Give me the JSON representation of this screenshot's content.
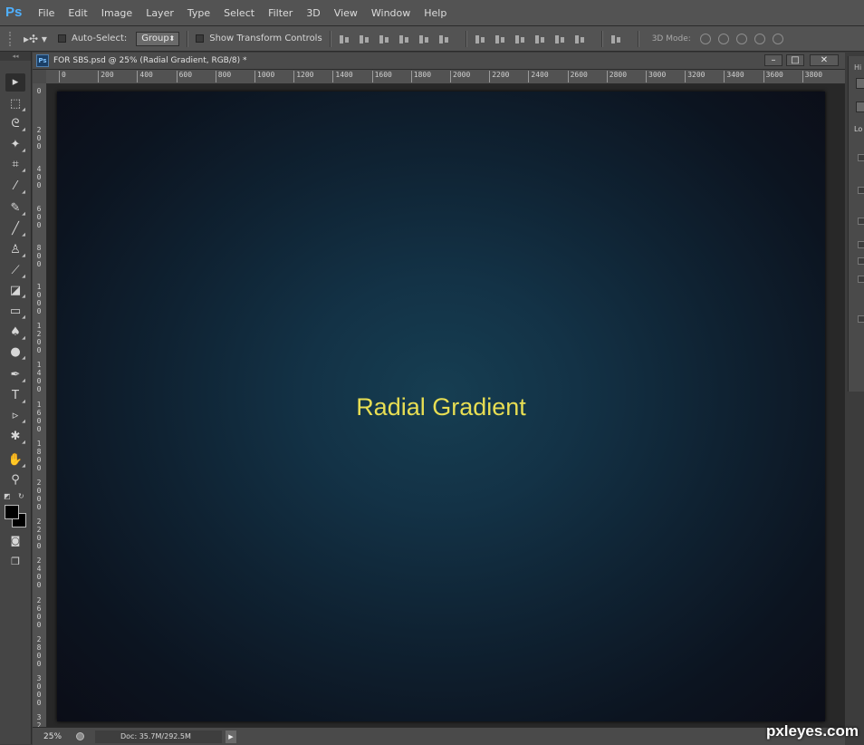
{
  "app": {
    "logo": "Ps"
  },
  "menu": [
    "File",
    "Edit",
    "Image",
    "Layer",
    "Type",
    "Select",
    "Filter",
    "3D",
    "View",
    "Window",
    "Help"
  ],
  "options_bar": {
    "move_glyph": "▸✣ ▾",
    "auto_select_label": "Auto-Select:",
    "group_value": "Group",
    "transform_label": "Show Transform Controls",
    "mode_3d_label": "3D Mode:"
  },
  "tools": [
    {
      "name": "move-tool",
      "glyph": "▸"
    },
    {
      "name": "marquee-tool",
      "glyph": "⬚"
    },
    {
      "name": "lasso-tool",
      "glyph": "ᘓ"
    },
    {
      "name": "magic-wand-tool",
      "glyph": "✦"
    },
    {
      "name": "crop-tool",
      "glyph": "⌗"
    },
    {
      "name": "eyedropper-tool",
      "glyph": "⁄"
    },
    {
      "name": "healing-brush-tool",
      "glyph": "✎"
    },
    {
      "name": "brush-tool",
      "glyph": "╱"
    },
    {
      "name": "clone-stamp-tool",
      "glyph": "♙"
    },
    {
      "name": "history-brush-tool",
      "glyph": "⟋"
    },
    {
      "name": "eraser-tool",
      "glyph": "◪"
    },
    {
      "name": "gradient-tool",
      "glyph": "▭"
    },
    {
      "name": "blur-tool",
      "glyph": "♠"
    },
    {
      "name": "dodge-tool",
      "glyph": "●"
    },
    {
      "name": "pen-tool",
      "glyph": "✒"
    },
    {
      "name": "type-tool",
      "glyph": "T"
    },
    {
      "name": "path-selection-tool",
      "glyph": "▹"
    },
    {
      "name": "custom-shape-tool",
      "glyph": "✱"
    },
    {
      "name": "hand-tool",
      "glyph": "✋"
    },
    {
      "name": "zoom-tool",
      "glyph": "⚲"
    }
  ],
  "document": {
    "tab_icon": "Ps",
    "title": "FOR SBS.psd @ 25% (Radial Gradient, RGB/8) *",
    "minimize": "–",
    "maximize": "□",
    "close": "✕",
    "h_ruler": [
      "0",
      "200",
      "400",
      "600",
      "800",
      "1000",
      "1200",
      "1400",
      "1600",
      "1800",
      "2000",
      "2200",
      "2400",
      "2600",
      "2800",
      "3000",
      "3200",
      "3400",
      "3600",
      "3800"
    ],
    "v_ruler": [
      "0",
      "200",
      "400",
      "600",
      "800",
      "1000",
      "1200",
      "1400",
      "1600",
      "1800",
      "2000",
      "2200",
      "2400",
      "2600",
      "2800",
      "3000",
      "3200"
    ],
    "canvas_text": "Radial Gradient",
    "canvas_text_color": "#e8de53",
    "gradient_center": "#163e52",
    "gradient_edge": "#0b0d17"
  },
  "status": {
    "zoom": "25%",
    "doc_size": "Doc: 35.7M/292.5M",
    "arrow": "▶"
  },
  "right_panel": {
    "title": "Hi",
    "lock_label": "Lo"
  },
  "watermark": "pxleyes.com"
}
